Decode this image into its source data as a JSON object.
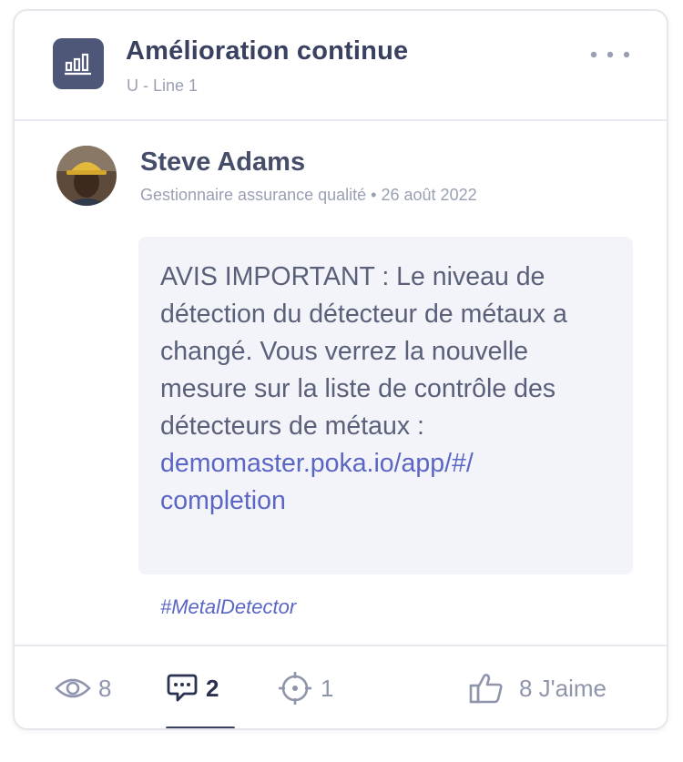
{
  "channel": {
    "title": "Amélioration continue",
    "subtitle": "U - Line 1",
    "icon": "bar-chart-icon",
    "more_icon": "more-horizontal-icon"
  },
  "post": {
    "author_name": "Steve Adams",
    "author_role": "Gestionnaire assurance qualité",
    "separator": "•",
    "date": "26 août 2022",
    "body": "AVIS IMPORTANT : Le niveau de détection du détecteur de métaux a changé. Vous verrez la nouvelle mesure sur la liste de contrôle des détecteurs de métaux :",
    "link": "demomaster.poka.io/app/#/completion",
    "link_line1": "demomaster.poka.io/app/#/",
    "link_line2": "completion",
    "hashtag": "#MetalDetector"
  },
  "footer": {
    "views": {
      "icon": "eye-icon",
      "count": "8"
    },
    "comments": {
      "icon": "comment-icon",
      "count": "2",
      "active": true
    },
    "targets": {
      "icon": "target-icon",
      "count": "1"
    },
    "likes": {
      "icon": "thumbs-up-icon",
      "label": "8 J'aime"
    }
  },
  "colors": {
    "title": "#3a4160",
    "muted": "#9aa0b4",
    "link": "#5b66c4",
    "message_bg": "#f3f4fa",
    "channel_icon_bg": "#4e5778"
  }
}
